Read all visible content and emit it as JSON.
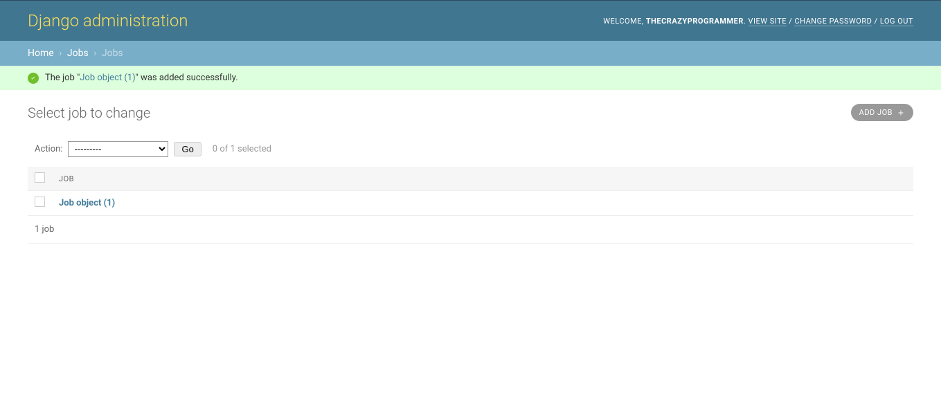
{
  "header": {
    "title": "Django administration",
    "welcome": "WELCOME,",
    "username": "THECRAZYPROGRAMMER",
    "view_site": "VIEW SITE",
    "change_password": "CHANGE PASSWORD",
    "logout": "LOG OUT"
  },
  "breadcrumbs": {
    "home": "Home",
    "jobs_link": "Jobs",
    "current": "Jobs"
  },
  "message": {
    "prefix": "The job \"",
    "link": "Job object (1)",
    "suffix": "\" was added successfully."
  },
  "content": {
    "title": "Select job to change",
    "add_button": "ADD JOB"
  },
  "actions": {
    "label": "Action:",
    "placeholder": "---------",
    "go": "Go",
    "counter": "0 of 1 selected"
  },
  "table": {
    "header_job": "JOB",
    "rows": [
      {
        "label": "Job object (1)"
      }
    ]
  },
  "paginator": "1 job"
}
